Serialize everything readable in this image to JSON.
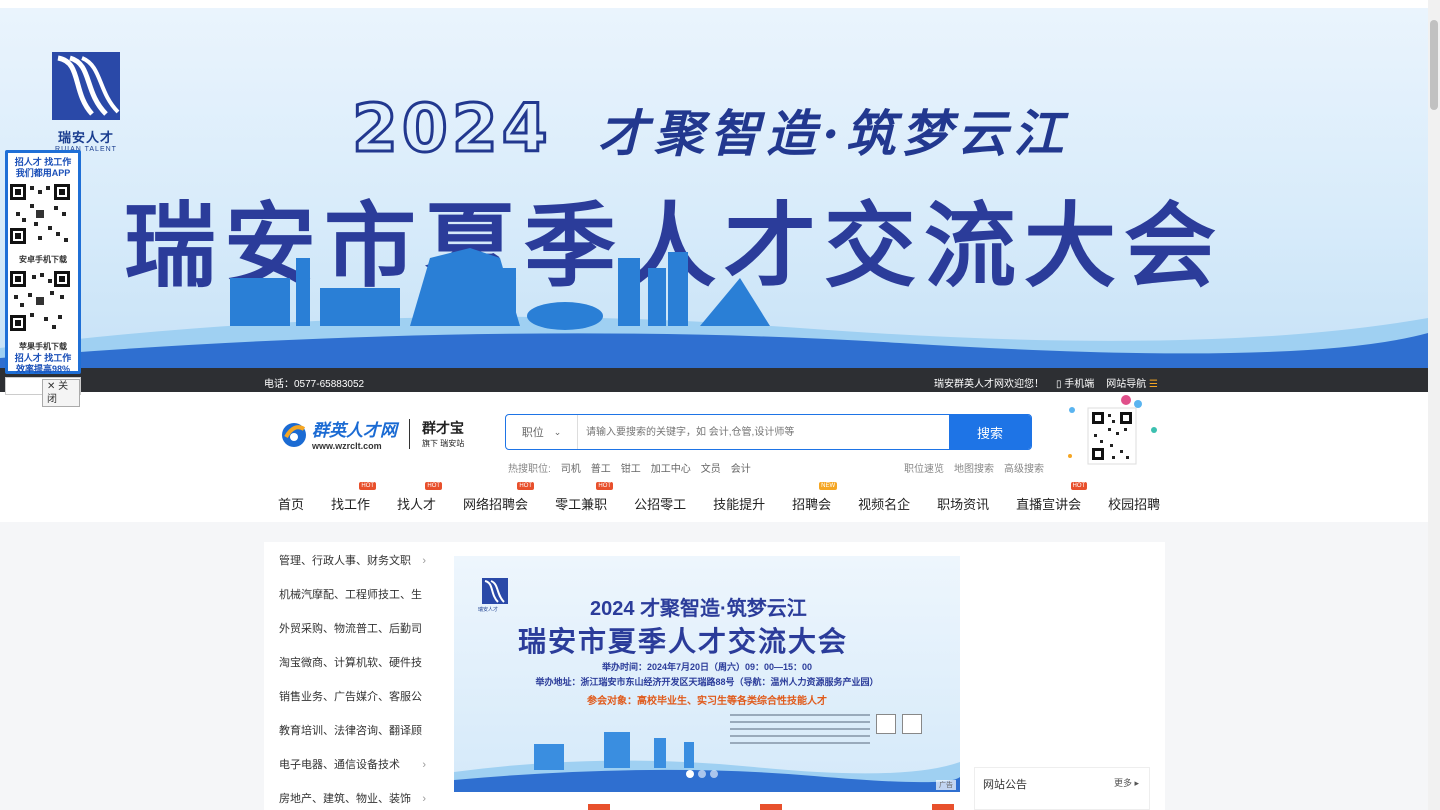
{
  "banner": {
    "year": "2024",
    "slogan": "才聚智造·筑梦云江",
    "headline": "瑞安市夏季人才交流大会",
    "logo_cn": "瑞安人才",
    "logo_en": "RUIAN TALENT"
  },
  "app_promo": {
    "line1": "招人才 找工作",
    "line2": "我们都用APP",
    "android": "安卓手机下载",
    "ios": "苹果手机下载",
    "line3": "招人才 找工作",
    "line4": "效率提高98%",
    "close": "✕ 关闭"
  },
  "topbar": {
    "phone": "电话：0577-65883052",
    "welcome": "瑞安群英人才网欢迎您！",
    "mobile": "手机端",
    "sitenav": "网站导航"
  },
  "header": {
    "brand": "群英人才网",
    "url": "www.wzrclt.com",
    "sub_brand": "群才宝",
    "sub_brand_note": "旗下 瑞安站"
  },
  "search": {
    "type": "职位",
    "placeholder": "请输入要搜索的关键字，如 会计,仓管,设计师等",
    "button": "搜索"
  },
  "hot": {
    "label": "热搜职位:",
    "items": [
      "司机",
      "普工",
      "钳工",
      "加工中心",
      "文员",
      "会计"
    ]
  },
  "adv_links": [
    "职位速览",
    "地图搜索",
    "高级搜索"
  ],
  "nav": [
    {
      "label": "首页",
      "badge": ""
    },
    {
      "label": "找工作",
      "badge": "HOT"
    },
    {
      "label": "找人才",
      "badge": "HOT"
    },
    {
      "label": "网络招聘会",
      "badge": "HOT"
    },
    {
      "label": "零工兼职",
      "badge": "HOT"
    },
    {
      "label": "公招零工",
      "badge": ""
    },
    {
      "label": "技能提升",
      "badge": ""
    },
    {
      "label": "招聘会",
      "badge": "NEW"
    },
    {
      "label": "视频名企",
      "badge": ""
    },
    {
      "label": "职场资讯",
      "badge": ""
    },
    {
      "label": "直播宣讲会",
      "badge": "HOT"
    },
    {
      "label": "校园招聘",
      "badge": ""
    }
  ],
  "categories": [
    "管理、行政人事、财务文职",
    "机械汽摩配、工程师技工、生",
    "外贸采购、物流普工、后勤司",
    "淘宝微商、计算机软、硬件技",
    "销售业务、广告媒介、客服公",
    "教育培训、法律咨询、翻译顾",
    "电子电器、通信设备技术",
    "房地产、建筑、物业、装饰"
  ],
  "slide": {
    "year": "2024",
    "slogan": "才聚智造·筑梦云江",
    "title": "瑞安市夏季人才交流大会",
    "time": "举办时间：2024年7月20日（周六）09：00—15：00",
    "address": "举办地址：浙江瑞安市东山经济开发区天瑞路88号（导航：温州人力资源服务产业园）",
    "audience": "参会对象：高校毕业生、实习生等各类综合性技能人才",
    "logo_text": "瑞安人才",
    "ad": "广告"
  },
  "notice": {
    "title": "网站公告",
    "more": "更多"
  }
}
